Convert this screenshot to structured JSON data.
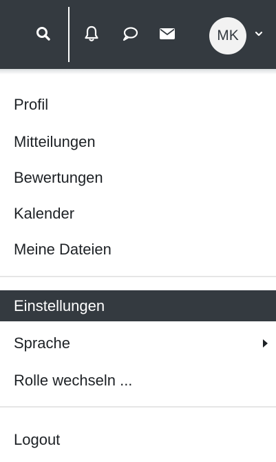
{
  "user": {
    "initials": "MK"
  },
  "menu": {
    "items": [
      {
        "label": "Profil"
      },
      {
        "label": "Mitteilungen"
      },
      {
        "label": "Bewertungen"
      },
      {
        "label": "Kalender"
      },
      {
        "label": "Meine Dateien"
      },
      {
        "label": "Einstellungen",
        "active": true
      },
      {
        "label": "Sprache",
        "has_submenu": true
      },
      {
        "label": "Rolle wechseln ..."
      },
      {
        "label": "Logout"
      }
    ]
  },
  "colors": {
    "topbar_bg": "#343a40",
    "active_item_bg": "#343a40",
    "text": "#1d2125"
  },
  "icons": [
    "search-icon",
    "bell-icon",
    "chat-icon",
    "envelope-icon",
    "chevron-down-icon",
    "caret-right-icon"
  ]
}
